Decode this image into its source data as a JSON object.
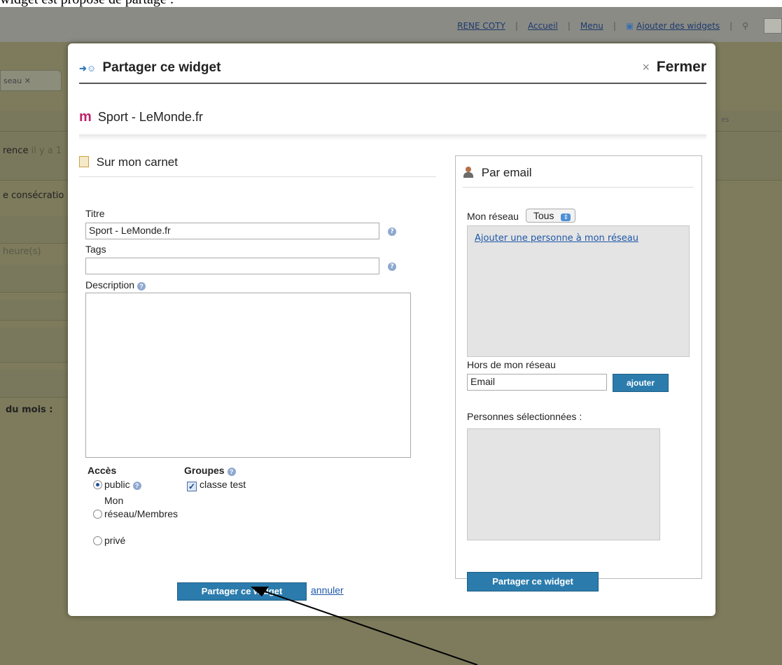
{
  "caption": "widget est proposé de partage :",
  "topbar": {
    "user": "RENE COTY",
    "home": "Accueil",
    "menu": "Menu",
    "add_widgets": "Ajouter des widgets"
  },
  "background": {
    "tab_label": "seau",
    "rows": [
      "rence",
      "il y a 1",
      "e consécratio",
      "heure(s)",
      "du mois :",
      "es"
    ]
  },
  "modal": {
    "title": "Partager ce widget",
    "close_label": "Fermer",
    "widget_name": "Sport - LeMonde.fr",
    "left": {
      "heading": "Sur mon carnet",
      "titre_label": "Titre",
      "titre_value": "Sport - LeMonde.fr",
      "tags_label": "Tags",
      "tags_value": "",
      "description_label": "Description",
      "acces_label": "Accès",
      "acces_options": [
        "public",
        "Mon réseau/Membres",
        "privé"
      ],
      "acces_selected": "public",
      "groupes_label": "Groupes",
      "group_name": "classe test",
      "submit_label": "Partager ce widget",
      "cancel_label": "annuler"
    },
    "right": {
      "heading": "Par email",
      "network_label": "Mon réseau",
      "network_select": "Tous",
      "add_person_link": "Ajouter une personne à mon réseau",
      "outside_label": "Hors de mon réseau",
      "email_placeholder": "Email",
      "add_button": "ajouter",
      "selected_label": "Personnes sélectionnées :",
      "submit_label": "Partager ce widget"
    }
  }
}
